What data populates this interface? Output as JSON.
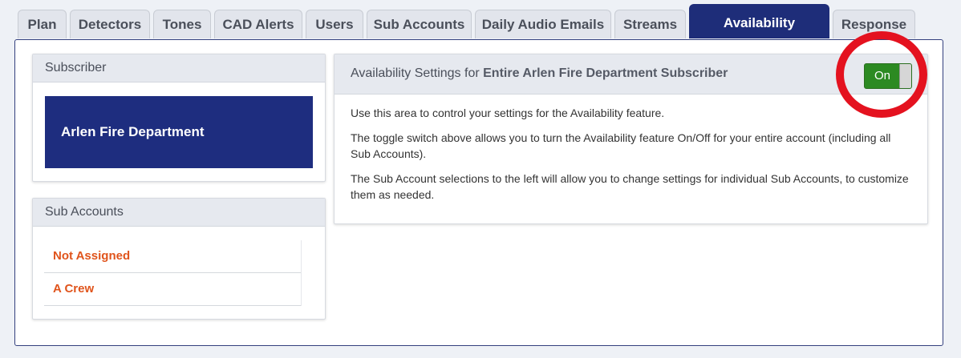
{
  "tabs": [
    {
      "label": "Plan"
    },
    {
      "label": "Detectors"
    },
    {
      "label": "Tones"
    },
    {
      "label": "CAD Alerts"
    },
    {
      "label": "Users"
    },
    {
      "label": "Sub Accounts"
    },
    {
      "label": "Daily Audio Emails"
    },
    {
      "label": "Streams"
    },
    {
      "label": "Availability"
    },
    {
      "label": "Response"
    }
  ],
  "active_tab": "Availability",
  "subscriber_panel": {
    "title": "Subscriber",
    "selected": "Arlen Fire Department"
  },
  "sub_accounts_panel": {
    "title": "Sub Accounts",
    "items": [
      {
        "label": "Not Assigned"
      },
      {
        "label": "A Crew"
      }
    ]
  },
  "availability_panel": {
    "title_prefix": "Availability Settings for ",
    "title_target": "Entire Arlen Fire Department Subscriber",
    "toggle_label": "On",
    "paragraphs": [
      "Use this area to control your settings for the Availability feature.",
      "The toggle switch above allows you to turn the Availability feature On/Off for your entire account (including all Sub Accounts).",
      "The Sub Account selections to the left will allow you to change settings for individual Sub Accounts, to customize them as needed."
    ]
  },
  "colors": {
    "active_tab": "#1e2d79",
    "subscriber_selected": "#1e2d7f",
    "sub_account_link": "#e0541c",
    "toggle_on": "#2c8a22",
    "highlight_ring": "#e4121f"
  }
}
